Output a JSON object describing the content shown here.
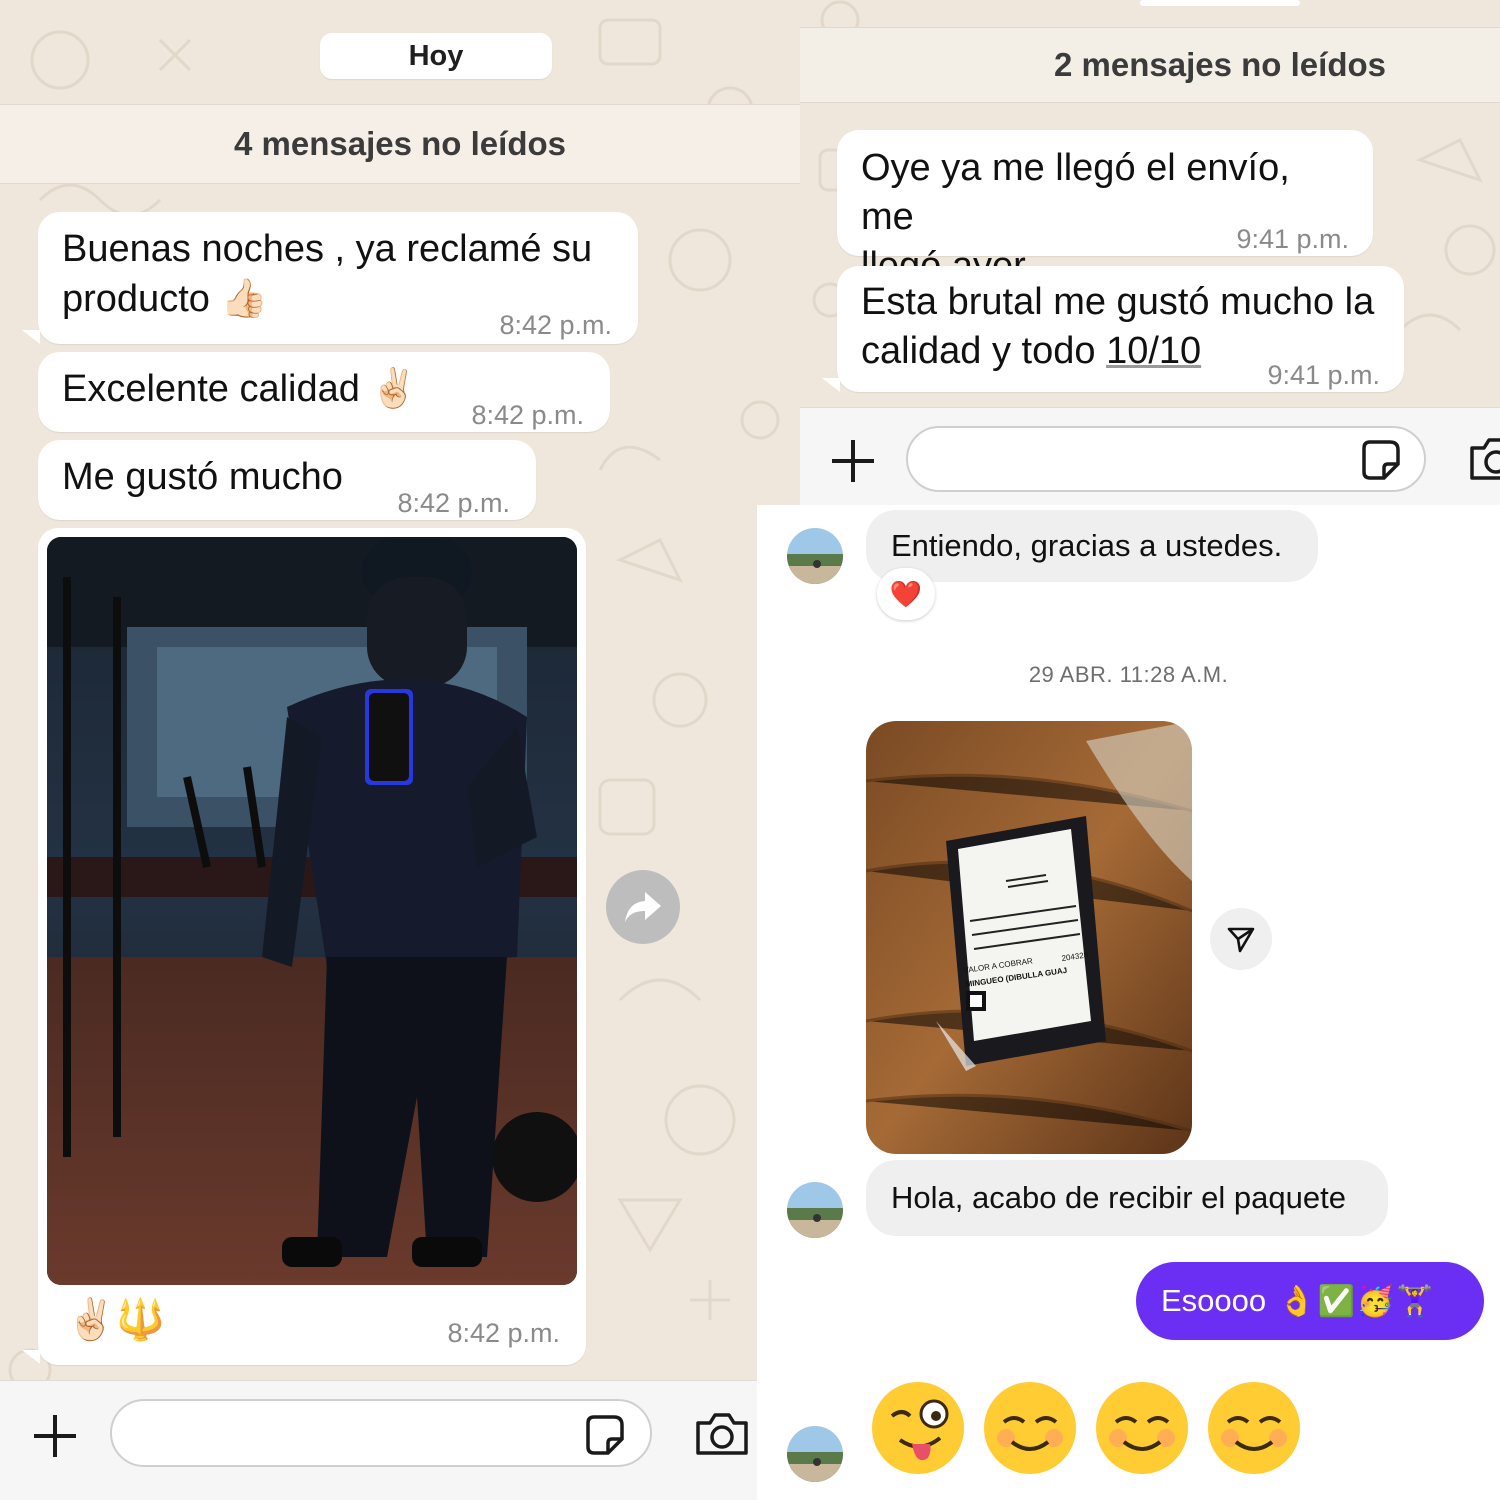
{
  "left_chat": {
    "date_label": "Hoy",
    "unread_label": "4 mensajes no leídos",
    "messages": [
      {
        "text": "Buenas noches , ya reclamé su producto 👍🏻",
        "time": "8:42 p.m."
      },
      {
        "text": "Excelente calidad ✌🏻",
        "time": "8:42 p.m."
      },
      {
        "text": "Me gustó mucho",
        "time": "8:42 p.m."
      }
    ],
    "media_message": {
      "reactions": "✌🏻🔱",
      "time": "8:42 p.m."
    },
    "composer": {
      "placeholder": ""
    }
  },
  "right_top_chat": {
    "unread_label": "2 mensajes no leídos",
    "messages": [
      {
        "line1": "Oye ya me llegó el envío, me",
        "line2": "llegó ayer",
        "time": "9:41 p.m."
      },
      {
        "line1": "Esta brutal me gustó mucho la",
        "line2_prefix": "calidad y todo ",
        "line2_link": "10/10",
        "time": "9:41 p.m."
      }
    ],
    "composer": {
      "placeholder": ""
    }
  },
  "right_bottom_chat": {
    "messages_in": [
      {
        "text": "Entiendo, gracias a ustedes.",
        "reaction": "❤️"
      },
      {
        "text": "Hola, acabo de recibir el paquete"
      }
    ],
    "date_separator": "29 ABR. 11:28 A.M.",
    "photo_label_text": {
      "line1": "VALOR A COBRAR",
      "line2": "MINGUEO (DIBULLA GUAJ",
      "number": "204328"
    },
    "message_out": {
      "text": "Esoooo",
      "emojis": "👌✅🥳🏋️‍♀️"
    }
  },
  "colors": {
    "wa_background": "#efe7dc",
    "ig_sent_bubble": "#6a2ff2",
    "ig_received_bubble": "#efefef"
  }
}
